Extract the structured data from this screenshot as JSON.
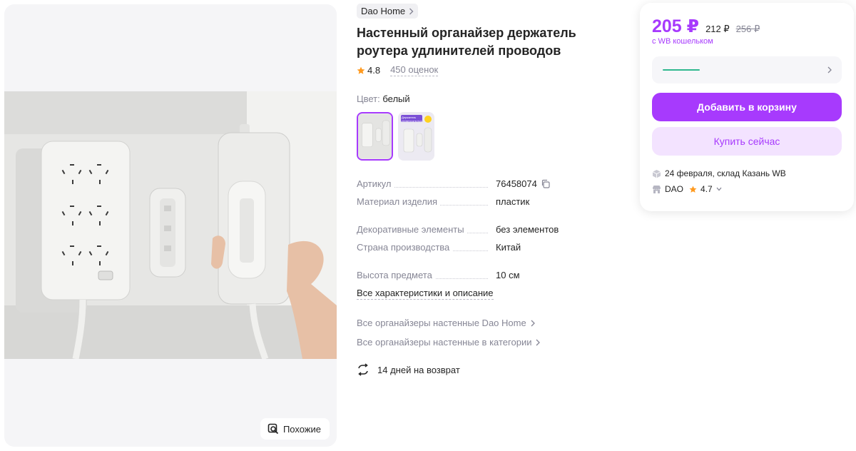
{
  "gallery": {
    "similar_label": "Похожие"
  },
  "product": {
    "brand": "Dao Home",
    "title": "Настенный органайзер держатель роутера удлинителей проводов",
    "rating": "4.8",
    "reviews": "450 оценок",
    "color_label": "Цвет:",
    "color_value": "белый",
    "thumb_text": "Держатель универсальный",
    "specs": [
      {
        "key": "Артикул",
        "value": "76458074"
      },
      {
        "key": "Материал изделия",
        "value": "пластик"
      },
      {
        "key": "Декоративные элементы",
        "value": "без элементов"
      },
      {
        "key": "Страна производства",
        "value": "Китай"
      },
      {
        "key": "Высота предмета",
        "value": "10 см"
      }
    ],
    "all_specs_link": "Все характеристики и описание",
    "category_links": [
      "Все органайзеры настенные Dao Home",
      "Все органайзеры настенные в категории"
    ],
    "return_policy": "14 дней на возврат"
  },
  "card": {
    "price_wallet": "205 ₽",
    "price": "212 ₽",
    "price_old": "256 ₽",
    "wallet_note": "с WB кошельком",
    "add_to_cart": "Добавить в корзину",
    "buy_now": "Купить сейчас",
    "delivery": "24 февраля, склад Казань WB",
    "seller_name": "DAO",
    "seller_rating": "4.7"
  },
  "colors": {
    "accent": "#a73afd",
    "accent_light": "#f3e3ff",
    "star": "#ff9a1f",
    "muted_text": "#868695",
    "selector_bar": "#2fb88e"
  }
}
